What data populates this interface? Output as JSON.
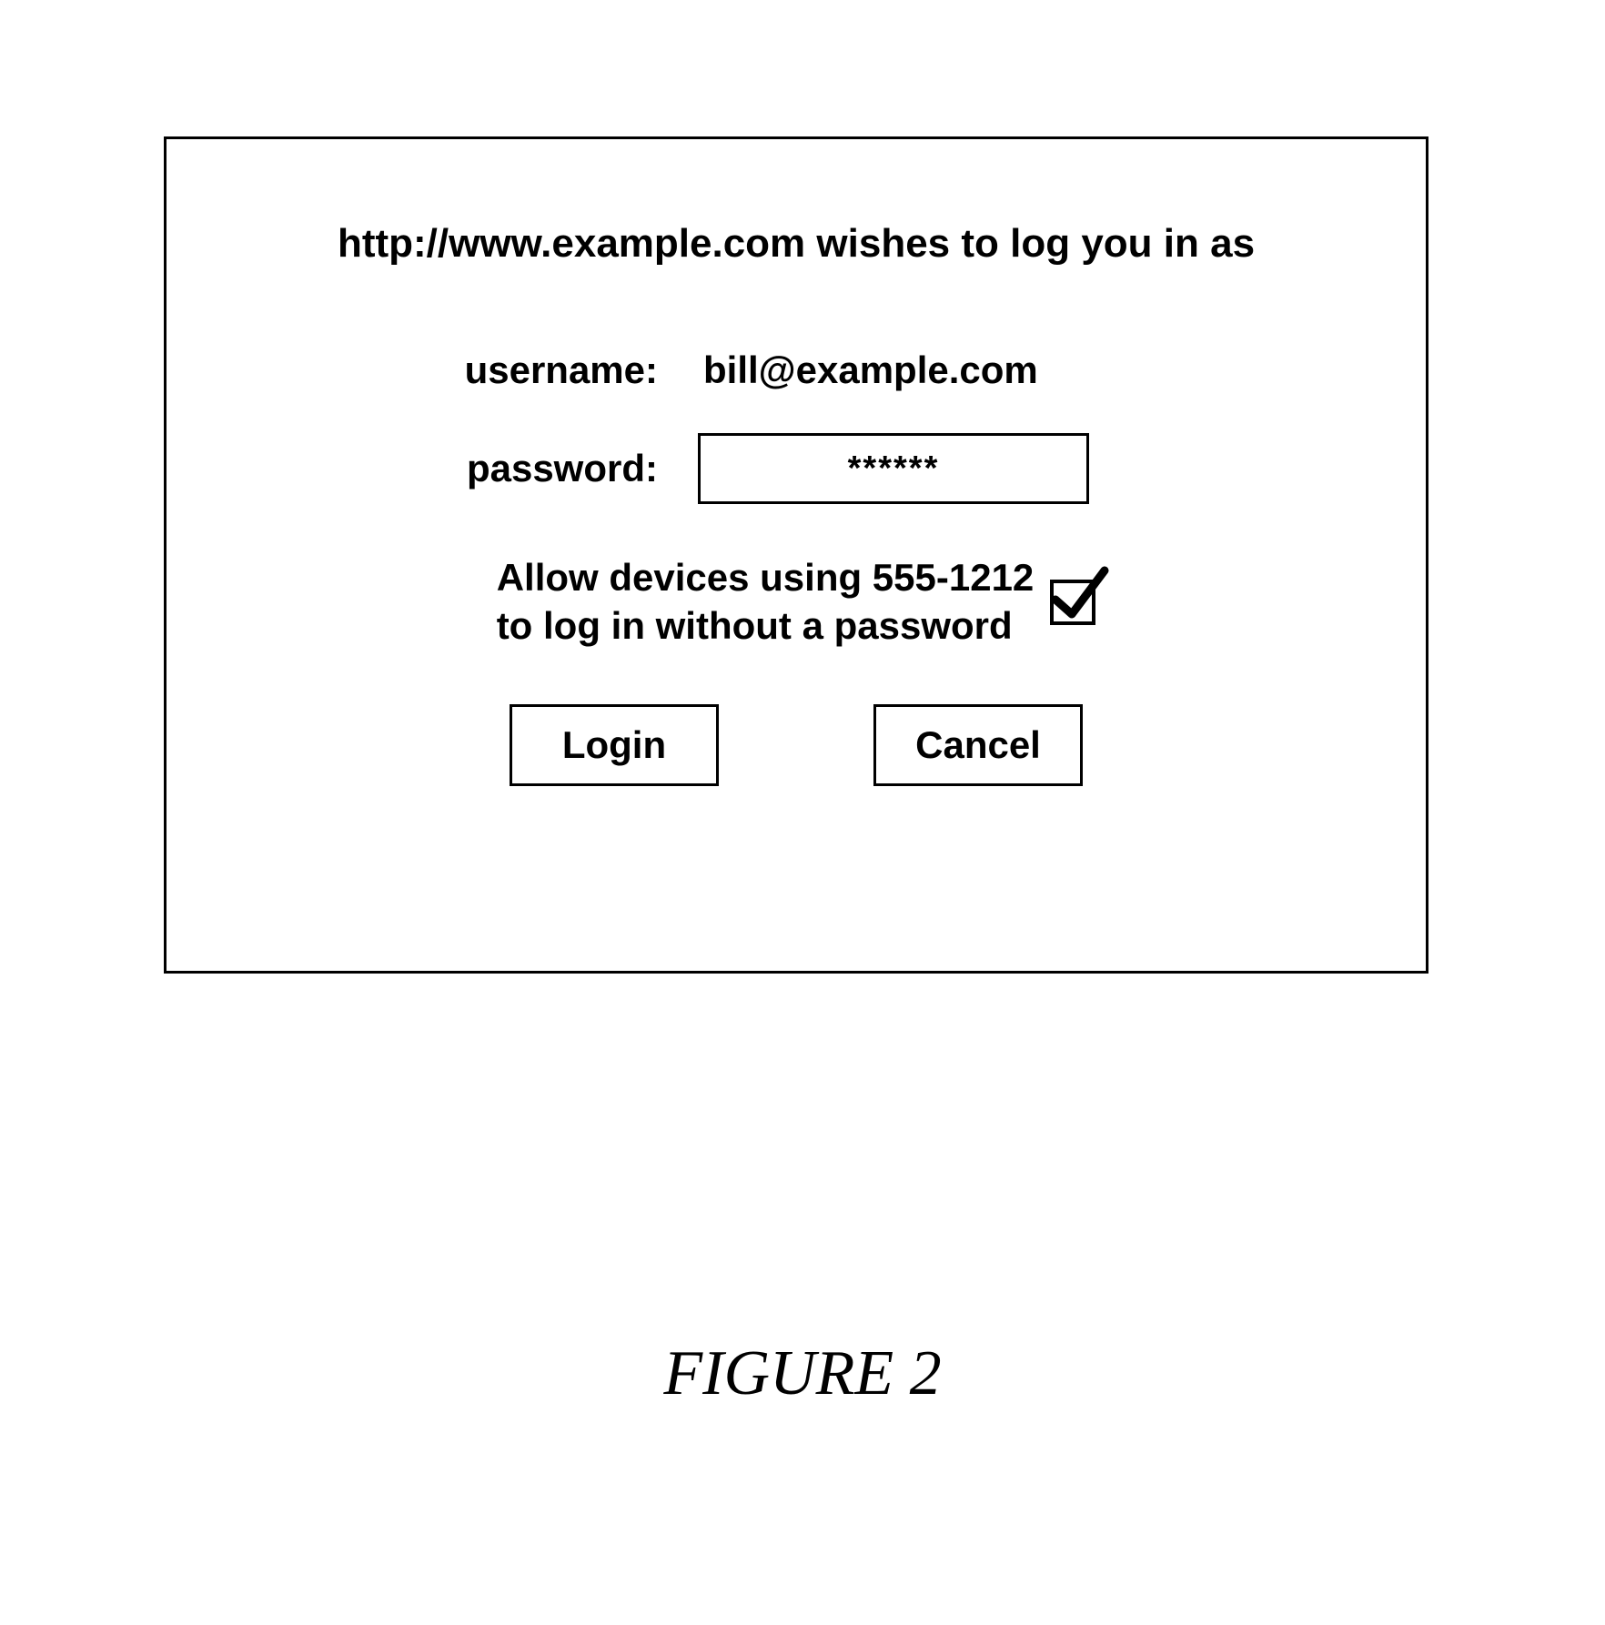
{
  "dialog": {
    "prompt": "http://www.example.com wishes to log you in as",
    "username_label": "username:",
    "username_value": "bill@example.com",
    "password_label": "password:",
    "password_value": "******",
    "allow_text_line1": "Allow devices using 555-1212",
    "allow_text_line2": "to log in without a password",
    "allow_checked": true,
    "login_button": "Login",
    "cancel_button": "Cancel"
  },
  "caption": "FIGURE 2"
}
